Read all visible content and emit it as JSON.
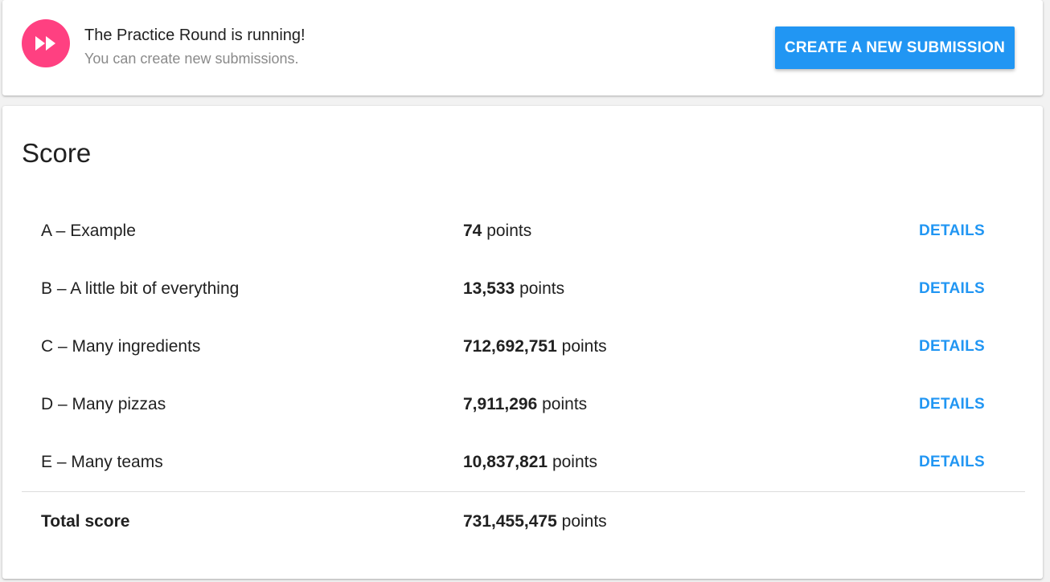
{
  "banner": {
    "icon": "fast-forward-icon",
    "accent_color": "#ff4081",
    "title": "The Practice Round is running!",
    "subtitle": "You can create new submissions.",
    "create_button_label": "CREATE A NEW SUBMISSION",
    "button_color": "#2196f3"
  },
  "score": {
    "title": "Score",
    "unit": "points",
    "details_label": "DETAILS",
    "rows": [
      {
        "name": "A – Example",
        "value": "74"
      },
      {
        "name": "B – A little bit of everything",
        "value": "13,533"
      },
      {
        "name": "C – Many ingredients",
        "value": "712,692,751"
      },
      {
        "name": "D – Many pizzas",
        "value": "7,911,296"
      },
      {
        "name": "E – Many teams",
        "value": "10,837,821"
      }
    ],
    "total": {
      "name": "Total score",
      "value": "731,455,475"
    }
  }
}
